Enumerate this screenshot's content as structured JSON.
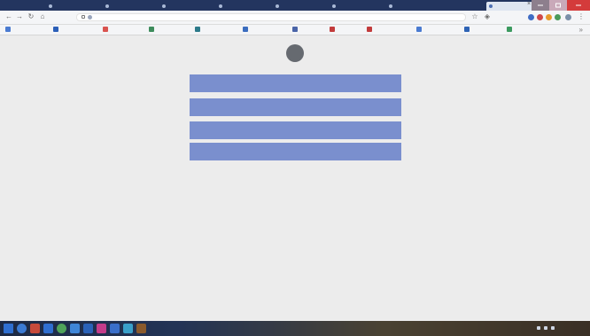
{
  "browser": {
    "tabs": [
      {
        "title": "",
        "active": false
      },
      {
        "title": "",
        "active": false
      },
      {
        "title": "",
        "active": false
      },
      {
        "title": "",
        "active": false
      },
      {
        "title": "",
        "active": false
      },
      {
        "title": "",
        "active": false
      },
      {
        "title": "",
        "active": false
      },
      {
        "title": "",
        "active": true
      },
      {
        "title": "",
        "active": false
      }
    ],
    "address": "",
    "bookmarks": [
      {
        "label": "",
        "color": "#4a7bd1"
      },
      {
        "label": "",
        "color": "#2b5fb8"
      },
      {
        "label": "",
        "color": "#d9534f"
      },
      {
        "label": "",
        "color": "#3d8c5c"
      },
      {
        "label": "",
        "color": "#2c7a8a"
      },
      {
        "label": "",
        "color": "#3b6dbf"
      },
      {
        "label": "",
        "color": "#4a64a8"
      },
      {
        "label": "",
        "color": "#c23b3b"
      },
      {
        "label": "",
        "color": "#c23b3b"
      },
      {
        "label": "",
        "color": "#4a7bd1"
      },
      {
        "label": "",
        "color": "#2e63b5"
      },
      {
        "label": "",
        "color": "#3c9a5f"
      }
    ]
  },
  "profile": {
    "username": "",
    "links": [
      "",
      "",
      "",
      ""
    ],
    "footer": ""
  },
  "taskbar": {
    "clock": ""
  },
  "colors": {
    "button": "#7a8fce",
    "tab_strip": "#23355f",
    "page_background": "#ececec"
  }
}
